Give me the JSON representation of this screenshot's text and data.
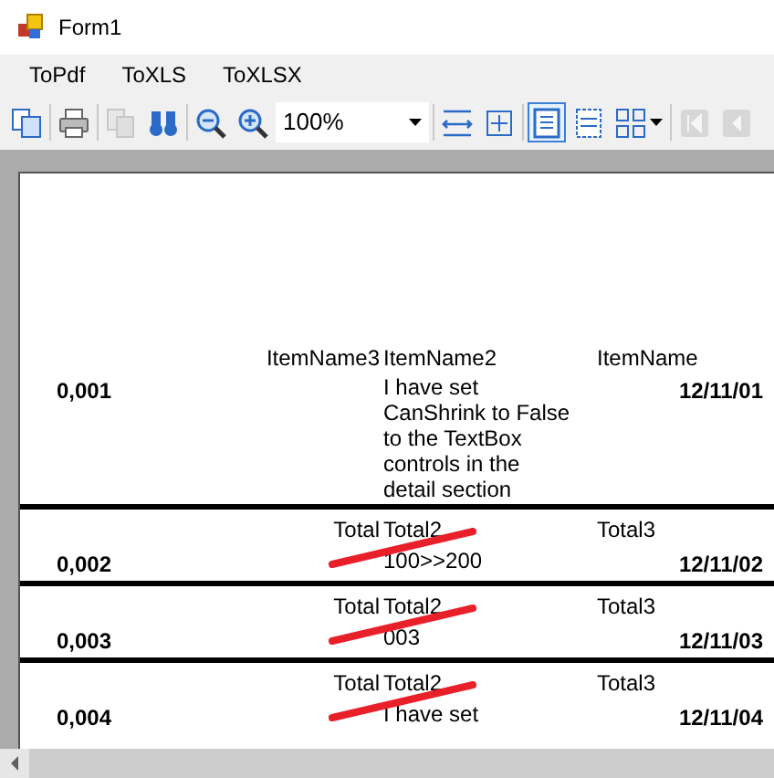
{
  "window": {
    "title": "Form1"
  },
  "menu": [
    {
      "label": "ToPdf"
    },
    {
      "label": "ToXLS"
    },
    {
      "label": "ToXLSX"
    }
  ],
  "toolbar": {
    "zoom": "100%",
    "buttons": [
      {
        "disabled": false,
        "selected": false
      },
      {
        "disabled": false,
        "selected": false
      },
      {
        "disabled": true,
        "selected": false
      },
      {
        "disabled": false,
        "selected": false
      },
      {
        "disabled": false,
        "selected": false
      },
      {
        "disabled": false,
        "selected": false
      },
      {
        "disabled": false,
        "selected": false
      },
      {
        "disabled": false,
        "selected": false
      },
      {
        "disabled": false,
        "selected": true
      },
      {
        "disabled": false,
        "selected": false
      },
      {
        "disabled": false,
        "selected": false
      },
      {
        "disabled": true,
        "selected": false
      },
      {
        "disabled": true,
        "selected": false
      }
    ]
  },
  "report": {
    "header": {
      "column_1": "ItemName3",
      "column_2": "ItemName2",
      "column_3": "ItemName"
    },
    "records": [
      {
        "id": "0,001",
        "text": "I have set CanShrink to False to the TextBox controls in the detail section",
        "date": "12/11/01"
      },
      {
        "totals": {
          "column_1": "Total",
          "column_2": "Total2",
          "column_3": "Total3"
        },
        "id": "0,002",
        "text": "100>>200",
        "date": "12/11/02"
      },
      {
        "totals": {
          "column_1": "Total",
          "column_2": "Total2",
          "column_3": "Total3"
        },
        "id": "0,003",
        "text": "003",
        "date": "12/11/03"
      },
      {
        "totals": {
          "column_1": "Total",
          "column_2": "Total2",
          "column_3": "Total3"
        },
        "id": "0,004",
        "text": "I have set",
        "date": "12/11/04"
      }
    ]
  }
}
